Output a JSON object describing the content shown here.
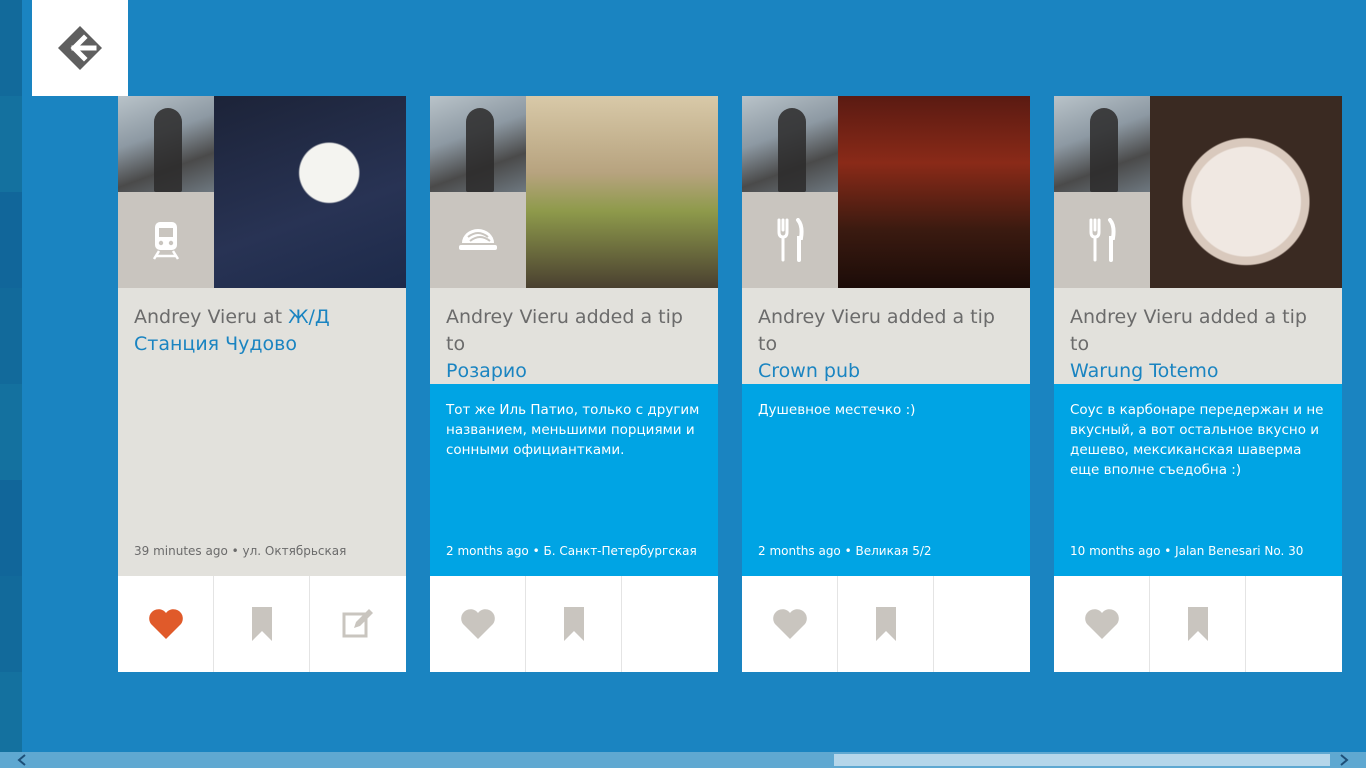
{
  "nav": {
    "back_icon": "back-arrow-icon"
  },
  "cards": [
    {
      "category_icon": "train-icon",
      "user": "Andrey Vieru",
      "action": "at",
      "venue_line1": "Ж/Д",
      "venue_line2": "Станция Чудово",
      "tip": "",
      "time": "39 minutes ago",
      "location": "ул. Октябрьская",
      "liked": true,
      "like_color": "#e05a2a"
    },
    {
      "category_icon": "dish-icon",
      "user": "Andrey Vieru",
      "action": "added a tip to",
      "venue": "Розарио",
      "tip": "Тот же Иль Патио, только с другим названием, меньшими порциями и сонными официантками.",
      "time": "2 months ago",
      "location": "Б. Санкт-Петербургская",
      "liked": false
    },
    {
      "category_icon": "fork-knife-icon",
      "user": "Andrey Vieru",
      "action": "added a tip to",
      "venue": "Crown pub",
      "tip": "Душевное местечко :)",
      "time": "2 months ago",
      "location": "Великая 5/2",
      "liked": false
    },
    {
      "category_icon": "fork-knife-icon",
      "user": "Andrey Vieru",
      "action": "added a tip to",
      "venue": "Warung Totemo",
      "tip": "Соус в карбонаре передержан и не вкусный, а вот остальное вкусно и дешево, мексиканская шаверма еще вполне съедобна :)",
      "time": "10 months ago",
      "location": "Jalan Benesari No. 30",
      "liked": false
    }
  ],
  "separator": " • ",
  "colors": {
    "background": "#1a84c1",
    "accent_blue": "#00a4e4",
    "card_grey": "#e2e1dc",
    "icon_grey": "#c9c5bf",
    "like_active": "#e05a2a"
  }
}
